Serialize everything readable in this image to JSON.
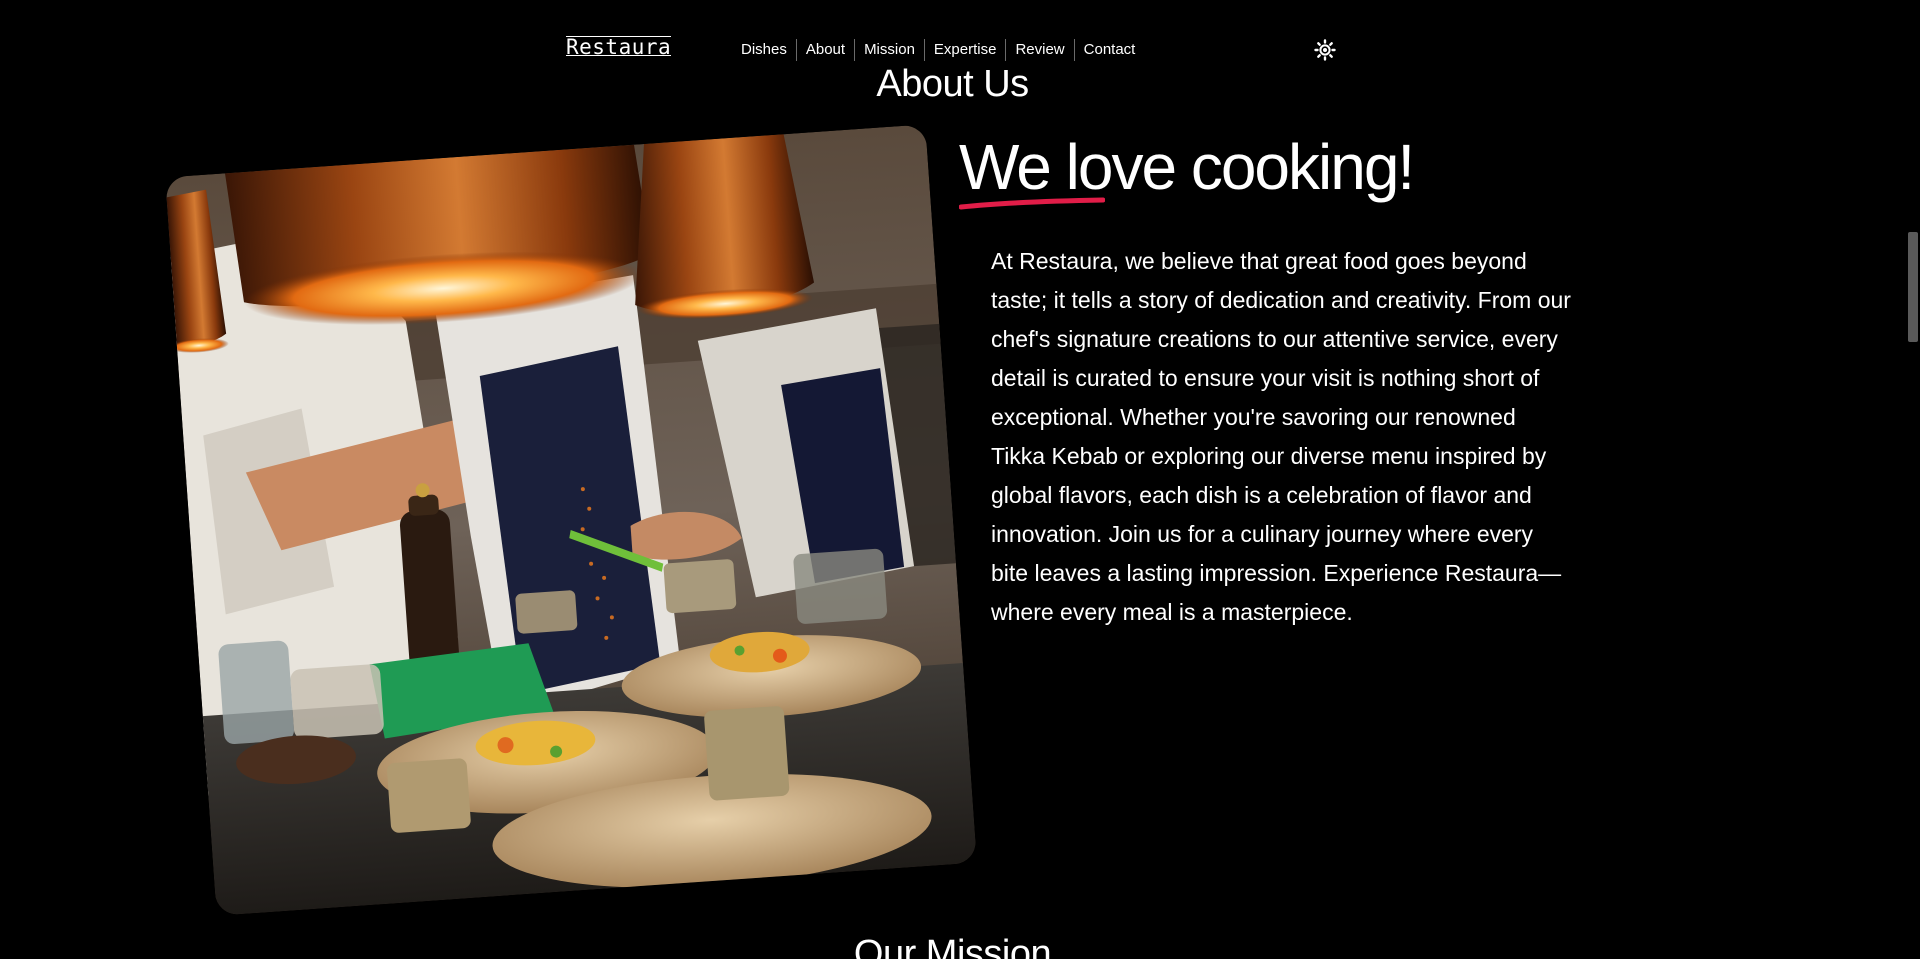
{
  "brand": {
    "logo": "Restaura"
  },
  "nav": {
    "items": [
      {
        "label": "Dishes"
      },
      {
        "label": "About"
      },
      {
        "label": "Mission"
      },
      {
        "label": "Expertise"
      },
      {
        "label": "Review"
      },
      {
        "label": "Contact"
      }
    ],
    "theme_toggle_icon": "sun-icon"
  },
  "about": {
    "section_title": "About Us",
    "headline": "We love cooking!",
    "underline_color": "#e11d48",
    "photo_icon": "kitchen-chefs-photo",
    "paragraph": "At Restaura, we believe that great food goes beyond taste; it tells a story of dedication and creativity. From our chef's signature creations to our attentive service, every detail is curated to ensure your visit is nothing short of exceptional. Whether you're savoring our renowned Tikka Kebab or exploring our diverse menu inspired by global flavors, each dish is a celebration of flavor and innovation. Join us for a culinary journey where every bite leaves a lasting impression. Experience Restaura—where every meal is a masterpiece."
  },
  "mission": {
    "section_title": "Our Mission"
  },
  "colors": {
    "background": "#000000",
    "text": "#ffffff",
    "accent": "#e11d48"
  }
}
